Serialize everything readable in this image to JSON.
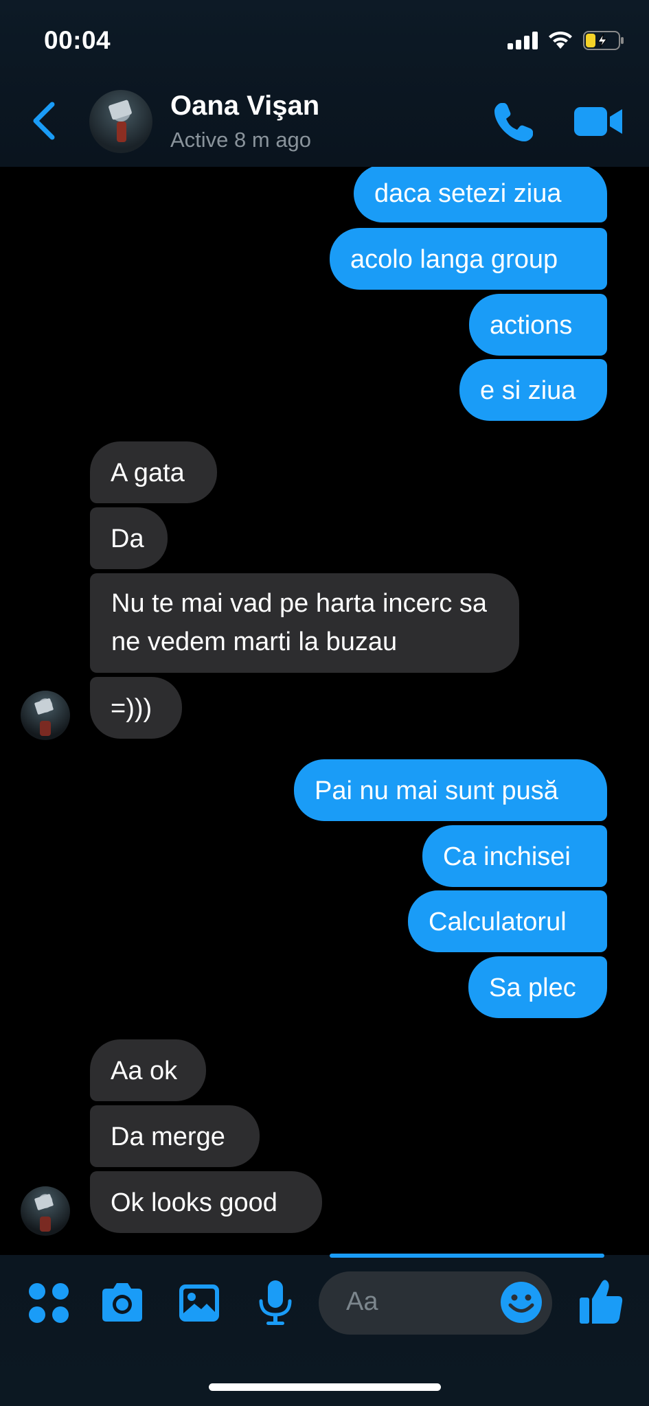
{
  "status_bar": {
    "time": "00:04"
  },
  "header": {
    "contact_name": "Oana Vişan",
    "presence": "Active 8 m ago"
  },
  "messages": [
    {
      "from": "me",
      "text": "daca setezi ziua"
    },
    {
      "from": "me",
      "text": "acolo langa group"
    },
    {
      "from": "me",
      "text": "actions"
    },
    {
      "from": "me",
      "text": "e si ziua"
    },
    {
      "from": "them",
      "text": "A gata"
    },
    {
      "from": "them",
      "text": "Da"
    },
    {
      "from": "them",
      "text": "Nu te mai vad pe harta incerc sa ne vedem marti la buzau"
    },
    {
      "from": "them",
      "text": "=)))"
    },
    {
      "from": "me",
      "text": "Pai nu mai sunt pusă"
    },
    {
      "from": "me",
      "text": "Ca inchisei"
    },
    {
      "from": "me",
      "text": "Calculatorul"
    },
    {
      "from": "me",
      "text": "Sa plec"
    },
    {
      "from": "them",
      "text": "Aa ok"
    },
    {
      "from": "them",
      "text": "Da merge"
    },
    {
      "from": "them",
      "text": "Ok looks good"
    }
  ],
  "composer": {
    "placeholder": "Aa"
  },
  "icons": {
    "back": "chevron-left-icon",
    "call": "phone-icon",
    "video": "video-camera-icon",
    "apps": "four-dots-icon",
    "camera": "camera-icon",
    "gallery": "image-icon",
    "mic": "microphone-icon",
    "emoji": "smiley-icon",
    "like": "thumbs-up-icon"
  },
  "colors": {
    "accent": "#1a9cf7",
    "incoming_bubble": "#2d2d2f",
    "background": "#000000"
  }
}
